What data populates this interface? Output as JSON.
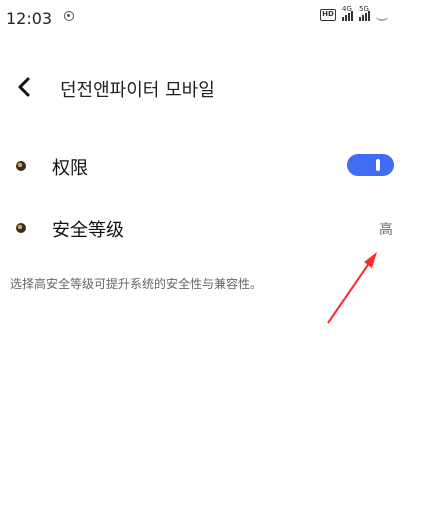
{
  "status_bar": {
    "time": "12:03",
    "hd_label": "HD",
    "signal_4g_label": "4G",
    "signal_5g_label": "5G",
    "icons": [
      "notification-dot-icon",
      "hd-icon",
      "signal-4g-icon",
      "signal-5g-icon",
      "wifi-icon"
    ]
  },
  "header": {
    "title": "던전앤파이터 모바일",
    "back_icon": "chevron-left-icon"
  },
  "settings": {
    "permissions_label": "权限",
    "permissions_toggle_on": true,
    "security_level_label": "安全等级",
    "security_level_value": "高",
    "description": "选择高安全等级可提升系统的安全性与兼容性。"
  },
  "colors": {
    "toggle_active": "#3f6cf2",
    "annotation_arrow": "#ff2a2a",
    "value_text": "#6b6b6b"
  }
}
